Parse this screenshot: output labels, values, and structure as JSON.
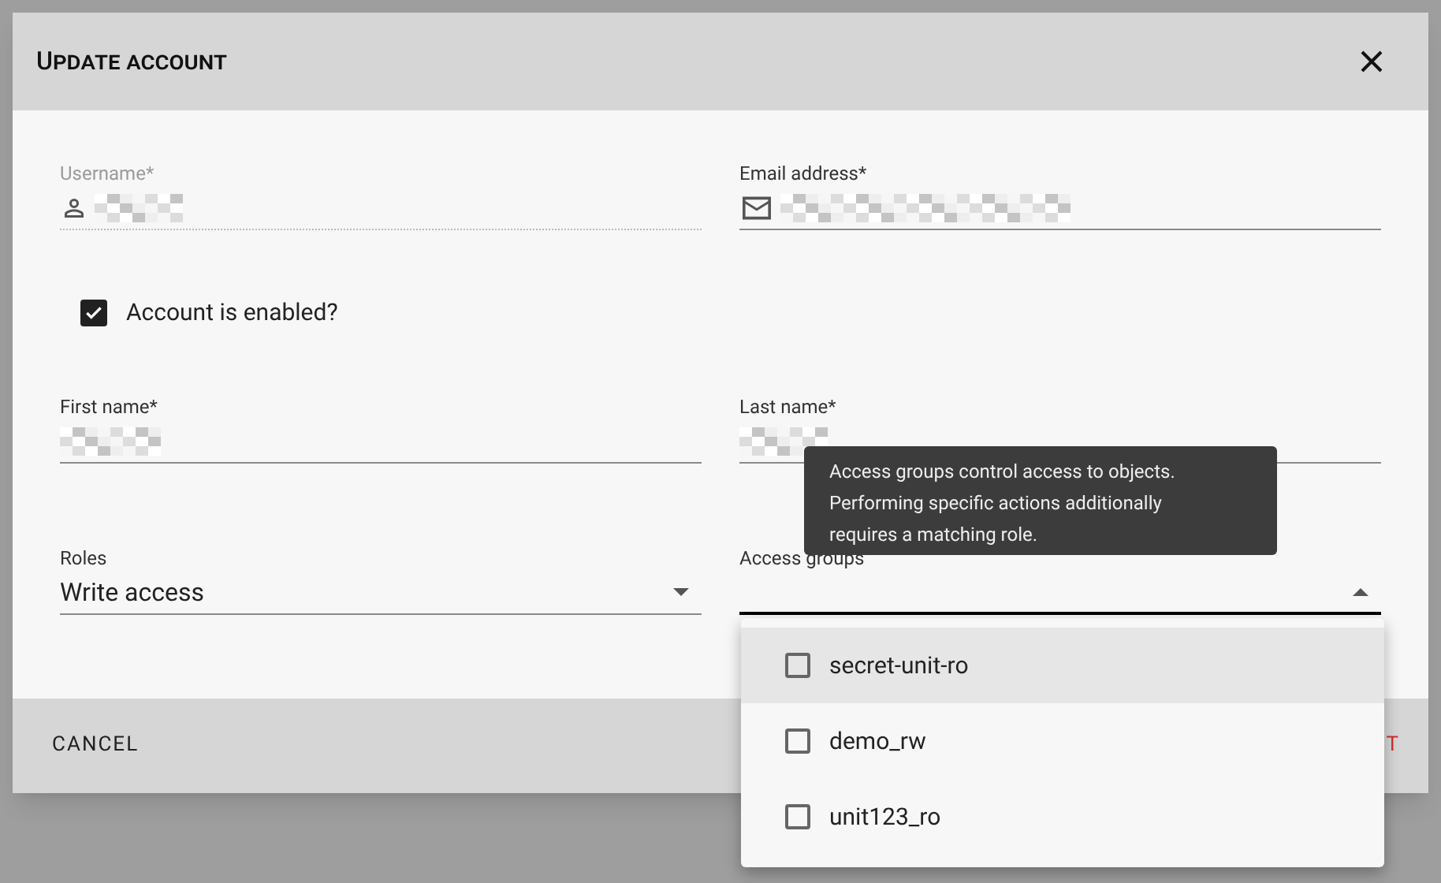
{
  "dialog": {
    "title": "Update account",
    "fields": [
      {
        "kind": "text",
        "label": "Username*",
        "disabled": true
      },
      {
        "kind": "text",
        "label": "Email address*",
        "disabled": false
      },
      {
        "kind": "checkbox",
        "label": "Account is enabled?",
        "checked": true
      },
      {
        "kind": "text",
        "label": "First name*",
        "disabled": false
      },
      {
        "kind": "text",
        "label": "Last name*",
        "disabled": false
      },
      {
        "kind": "select",
        "label": "Roles",
        "value": "Write access",
        "open": false
      },
      {
        "kind": "select",
        "label": "Access groups",
        "open": true
      }
    ],
    "actions": [
      {
        "label": "CANCEL",
        "kind": "plain"
      },
      {
        "label": "T",
        "kind": "danger"
      }
    ]
  },
  "tooltip": {
    "lines": [
      "Access groups control access to objects.",
      "Performing specific actions additionally",
      "requires a matching role."
    ]
  },
  "dropdown": {
    "options": [
      {
        "label": "secret-unit-ro",
        "checked": false,
        "highlighted": true
      },
      {
        "label": "demo_rw",
        "checked": false,
        "highlighted": false
      },
      {
        "label": "unit123_ro",
        "checked": false,
        "highlighted": false
      }
    ]
  }
}
